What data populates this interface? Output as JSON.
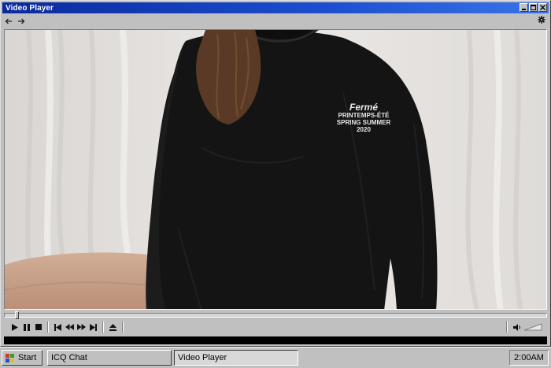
{
  "window": {
    "title": "Video Player"
  },
  "titlebar_buttons": {
    "minimize": "_",
    "maximize": "□",
    "close": "×"
  },
  "nav": {
    "back_icon": "arrow-left-icon",
    "forward_icon": "arrow-right-icon",
    "settings_icon": "gear-icon"
  },
  "video": {
    "shirt_print": [
      "Fermé",
      "PRINTEMPS-ÉTÉ",
      "SPRING SUMMER",
      "2020"
    ],
    "colors": {
      "backdrop": "#e6e3e0",
      "shirt": "#141414",
      "hair": "#5a3a26",
      "skin": "#c9a48c"
    }
  },
  "playback": {
    "progress": 0.02,
    "buttons": [
      "play-icon",
      "pause-icon",
      "stop-icon",
      "skip-back-icon",
      "rewind-icon",
      "fast-forward-icon",
      "skip-forward-icon",
      "eject-icon"
    ],
    "volume_icon": "speaker-icon"
  },
  "taskbar": {
    "start_label": "Start",
    "tasks": [
      {
        "label": "ICQ Chat",
        "active": false
      },
      {
        "label": "Video Player",
        "active": true
      }
    ],
    "clock": "2:00AM"
  }
}
